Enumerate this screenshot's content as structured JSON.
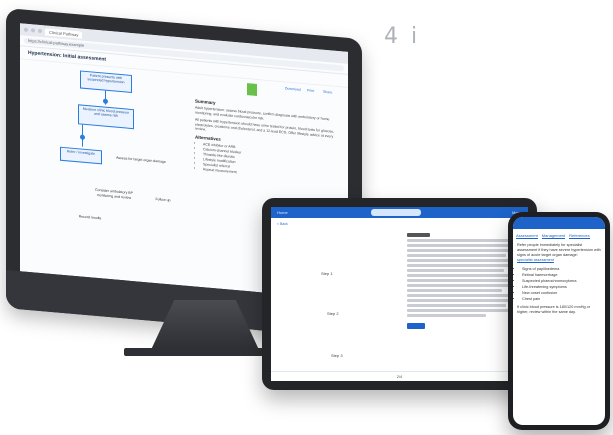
{
  "desktop": {
    "browser_tab": "Clinical Pathway",
    "url": "https://clinical-pathway.example",
    "app_title": "Hypertension: Initial assessment",
    "toolbar_links": [
      "Download",
      "Print",
      "Share"
    ],
    "flowchart": {
      "nodes": [
        "Patient presents with suspected hypertension",
        "Measure clinic blood pressure and assess risk",
        "Refer / investigate",
        "Record results"
      ],
      "side_notes": [
        "Assess for target organ damage",
        "Consider ambulatory BP monitoring and review",
        "Follow up"
      ]
    },
    "sections": [
      {
        "heading": "Summary",
        "paragraphs": [
          "Adult hypertension: assess blood pressure, confirm diagnosis with ambulatory or home monitoring, and evaluate cardiovascular risk.",
          "All patients with hypertension should have urine tested for protein, blood tests for glucose, electrolytes, creatinine and cholesterol, and a 12-lead ECG. Offer lifestyle advice at every review."
        ]
      },
      {
        "heading": "Alternatives",
        "bullets": [
          "ACE inhibitor or ARB",
          "Calcium-channel blocker",
          "Thiazide-like diuretic",
          "Lifestyle modification",
          "Specialist referral",
          "Repeat measurement"
        ]
      }
    ]
  },
  "tablet": {
    "top_left": "Home",
    "top_right": "Menu",
    "crumb": "< Back",
    "left_labels": [
      "Step 1",
      "Step 2",
      "Step 3"
    ],
    "bottom_label": "2/4"
  },
  "phone": {
    "tabs": [
      "Assessment",
      "Management",
      "References"
    ],
    "intro": "Refer people immediately for specialist assessment if they have severe hypertension with signs of acute target organ damage:",
    "link_text": "specialist assessment",
    "bullets": [
      "Signs of papilloedema",
      "Retinal haemorrhage",
      "Suspected phaeochromocytoma",
      "Life-threatening symptoms",
      "New onset confusion",
      "Chest pain"
    ],
    "footer": "If clinic blood pressure is 180/120 mmHg or higher, review within the same day."
  },
  "handwriting": "4 i"
}
